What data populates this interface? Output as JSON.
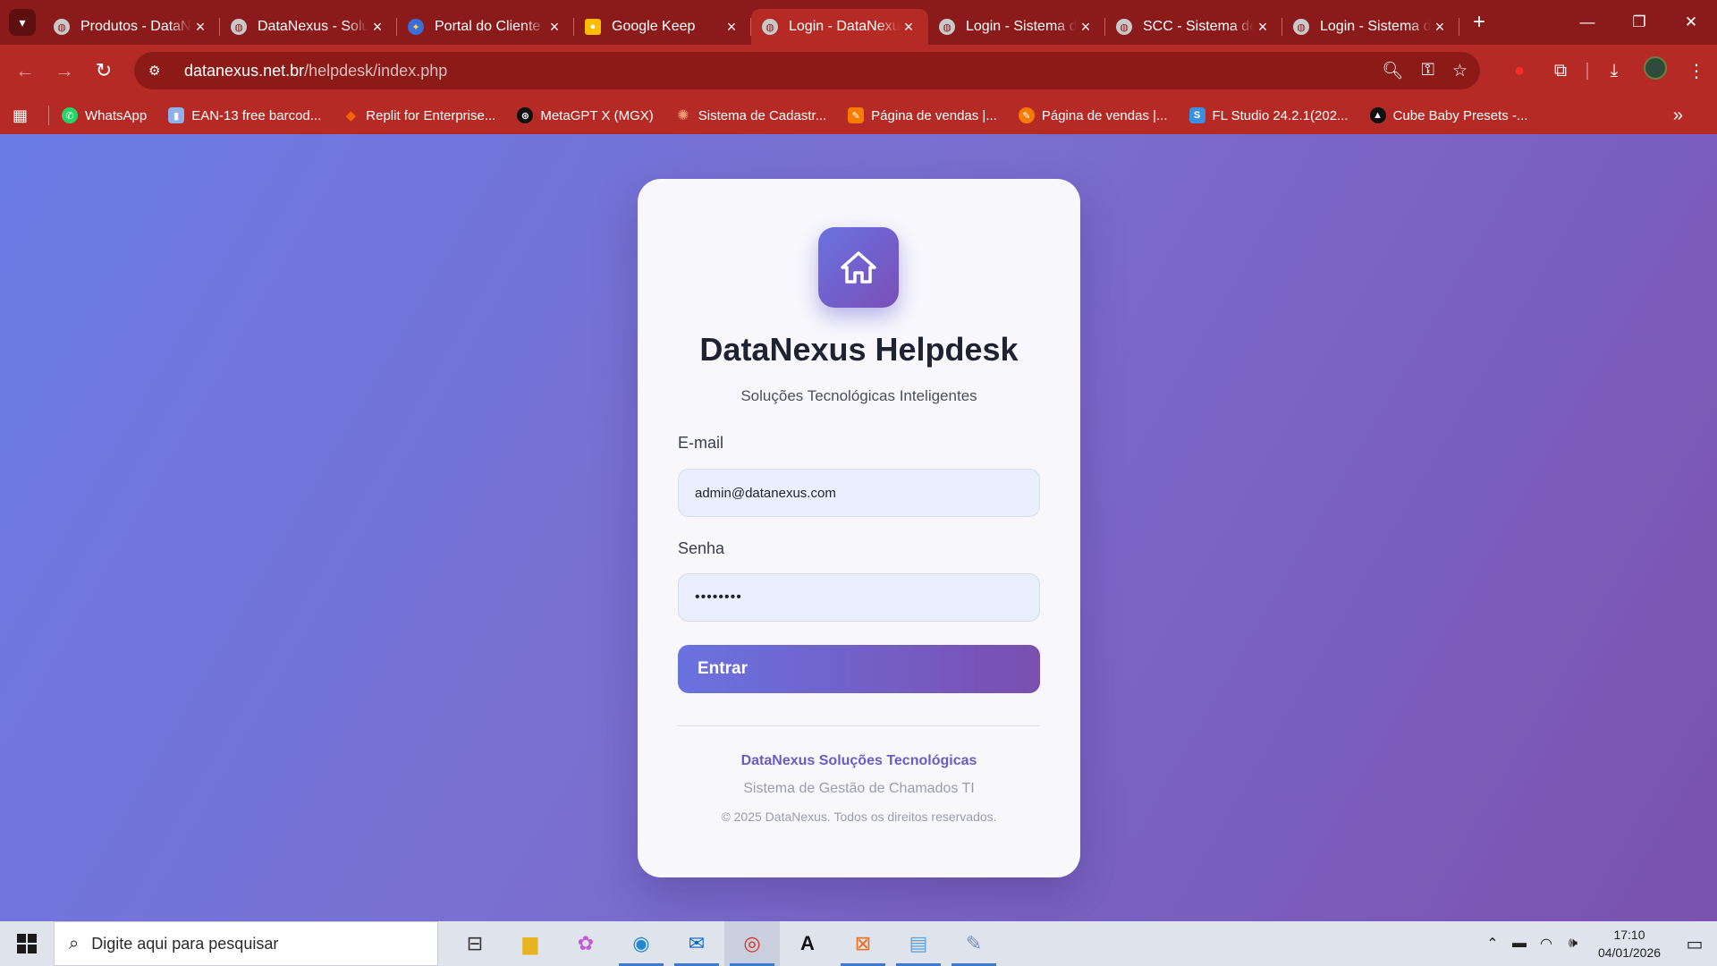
{
  "browser": {
    "tabs": [
      {
        "title": "Produtos - DataNexus",
        "active": false
      },
      {
        "title": "DataNexus - Soluções",
        "active": false
      },
      {
        "title": "Portal do Cliente",
        "active": false
      },
      {
        "title": "Google Keep",
        "active": false
      },
      {
        "title": "Login - DataNexus",
        "active": true
      },
      {
        "title": "Login - Sistema de",
        "active": false
      },
      {
        "title": "SCC - Sistema de",
        "active": false
      },
      {
        "title": "Login - Sistema de",
        "active": false
      }
    ],
    "url_host": "datanexus.net.br",
    "url_path": "/helpdesk/index.php",
    "bookmarks": [
      {
        "label": "WhatsApp",
        "color": "#25d366"
      },
      {
        "label": "EAN-13 free barcod...",
        "color": "#8fb0e8"
      },
      {
        "label": "Replit for Enterprise...",
        "color": "#f26207"
      },
      {
        "label": "MetaGPT X (MGX)",
        "color": "#111111"
      },
      {
        "label": "Sistema de Cadastr...",
        "color": "#d97757"
      },
      {
        "label": "Página de vendas |...",
        "color": "#f57c00"
      },
      {
        "label": "Página de vendas |...",
        "color": "#f57c00"
      },
      {
        "label": "FL Studio 24.2.1(202...",
        "color": "#3b8fe0"
      },
      {
        "label": "Cube Baby Presets -...",
        "color": "#111111"
      }
    ]
  },
  "login": {
    "title": "DataNexus Helpdesk",
    "subtitle": "Soluções Tecnológicas Inteligentes",
    "email_label": "E-mail",
    "email_value": "admin@datanexus.com",
    "password_label": "Senha",
    "password_value": "••••••••",
    "submit_label": "Entrar",
    "footer_company": "DataNexus Soluções Tecnológicas",
    "footer_system": "Sistema de Gestão de Chamados TI",
    "footer_copyright": "© 2025 DataNexus. Todos os direitos reservados."
  },
  "taskbar": {
    "search_placeholder": "Digite aqui para pesquisar",
    "time": "17:10",
    "date": "04/01/2026"
  },
  "colors": {
    "browser_frame": "#b52a25",
    "accent_start": "#6a72e0",
    "accent_end": "#7a4fb0"
  }
}
